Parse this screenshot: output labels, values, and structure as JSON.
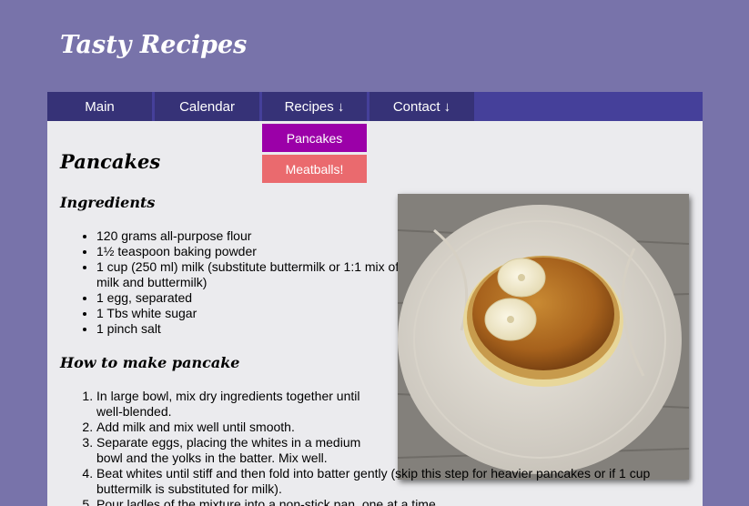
{
  "site": {
    "title": "Tasty Recipes"
  },
  "nav": {
    "items": [
      {
        "label": "Main"
      },
      {
        "label": "Calendar"
      },
      {
        "label": "Recipes ↓"
      },
      {
        "label": "Contact ↓"
      }
    ],
    "dropdown": [
      {
        "label": "Pancakes",
        "color": "#9b00a8"
      },
      {
        "label": "Meatballs!",
        "color": "#ea6a6e"
      }
    ]
  },
  "page": {
    "title": "Pancakes",
    "ingredients_title": "Ingredients",
    "ingredients": [
      "120 grams all-purpose flour",
      "1½ teaspoon baking powder",
      "1 cup (250 ml) milk (substitute buttermilk or 1:1 mix of milk and buttermilk)",
      "1 egg, separated",
      "1 Tbs white sugar",
      "1 pinch salt"
    ],
    "howto_title": "How to make pancake",
    "steps": [
      "In large bowl, mix dry ingredients together until well-blended.",
      "Add milk and mix well until smooth.",
      "Separate eggs, placing the whites in a medium bowl and the yolks in the batter. Mix well.",
      "Beat whites until stiff and then fold into batter gently (skip this step for heavier pancakes or if 1 cup buttermilk is substituted for milk).",
      "Pour ladles of the mixture into a non-stick pan, one at a time."
    ],
    "image": {
      "subject": "pancake stack with banana slices on white plate"
    }
  },
  "colors": {
    "background": "#7873aa",
    "navbar": "#45409a",
    "nav_item": "#363277",
    "content": "#ebebee"
  }
}
